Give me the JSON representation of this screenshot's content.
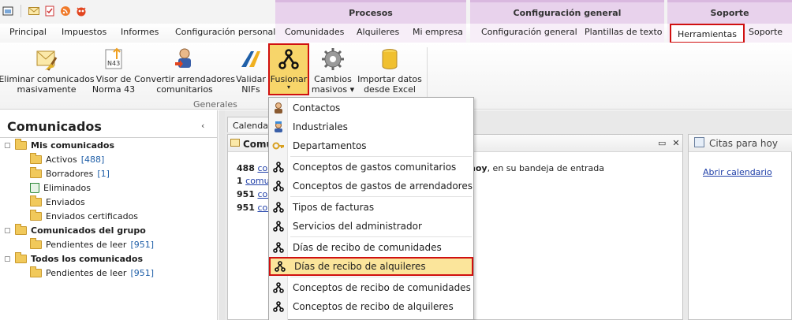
{
  "quick_access": {
    "icons": [
      "app-icon",
      "mail-icon",
      "checklist-icon",
      "rss-icon",
      "monster-icon"
    ]
  },
  "context_groups": {
    "procesos": "Procesos",
    "config": "Configuración general",
    "soporte": "Soporte"
  },
  "tabs": {
    "principal": "Principal",
    "impuestos": "Impuestos",
    "informes": "Informes",
    "config_personal": "Configuración personal",
    "comunidades": "Comunidades",
    "alquileres": "Alquileres",
    "mi_empresa": "Mi empresa",
    "config_general": "Configuración general",
    "plantillas": "Plantillas de texto",
    "herramientas": "Herramientas",
    "soporte": "Soporte"
  },
  "ribbon": {
    "eliminar": "Eliminar comunicados\nmasivamente",
    "visor": "Visor de\nNorma 43",
    "convertir": "Convertir arrendadores\ncomunitarios",
    "validar": "Validar\nNIFs",
    "fusionar": "Fusionar",
    "cambios": "Cambios\nmasivos ▾",
    "importar": "Importar datos\ndesde Excel",
    "group_label": "Generales"
  },
  "nav": {
    "title": "Comunicados",
    "collapse": "‹",
    "items": [
      {
        "label": "Mis comunicados",
        "count": ""
      },
      {
        "label": "Activos",
        "count": "[488]"
      },
      {
        "label": "Borradores",
        "count": "[1]"
      },
      {
        "label": "Eliminados",
        "count": ""
      },
      {
        "label": "Enviados",
        "count": ""
      },
      {
        "label": "Enviados certificados",
        "count": ""
      },
      {
        "label": "Comunicados del grupo",
        "count": ""
      },
      {
        "label": "Pendientes de leer",
        "count": "[951]"
      },
      {
        "label": "Todos los comunicados",
        "count": ""
      },
      {
        "label": "Pendientes de leer",
        "count": "[951]"
      }
    ]
  },
  "main": {
    "doc_tab": "Calendario",
    "panel_title": "Comunicados",
    "stats": [
      {
        "num": "488",
        "link": "com"
      },
      {
        "num": "1",
        "link": "comun"
      },
      {
        "num": "951",
        "link": "com"
      },
      {
        "num": "951",
        "link": "com"
      }
    ],
    "inbox_bold": "hoy",
    "inbox_rest": ", en su bandeja de entrada",
    "right_title": "Citas para hoy",
    "right_link": "Abrir calendario"
  },
  "menu": {
    "items": [
      {
        "label": "Contactos",
        "icon": "person-icon"
      },
      {
        "label": "Industriales",
        "icon": "worker-icon"
      },
      {
        "label": "Departamentos",
        "icon": "key-icon"
      },
      {
        "label": "Conceptos de gastos comunitarios",
        "icon": "merge-icon"
      },
      {
        "label": "Conceptos de gastos de arrendadores",
        "icon": "merge-icon"
      },
      {
        "label": "Tipos de facturas",
        "icon": "merge-icon"
      },
      {
        "label": "Servicios del administrador",
        "icon": "merge-icon"
      },
      {
        "label": "Días de recibo de comunidades",
        "icon": "merge-icon"
      },
      {
        "label": "Días de recibo de alquileres",
        "icon": "merge-icon"
      },
      {
        "label": "Conceptos de recibo de comunidades",
        "icon": "merge-icon"
      },
      {
        "label": "Conceptos de recibo de alquileres",
        "icon": "merge-icon"
      }
    ]
  },
  "colors": {
    "highlight_border": "#d01010",
    "highlight_fill": "#fbe59b",
    "link": "#1f3fa8",
    "context_tab": "#e8d2ec"
  }
}
